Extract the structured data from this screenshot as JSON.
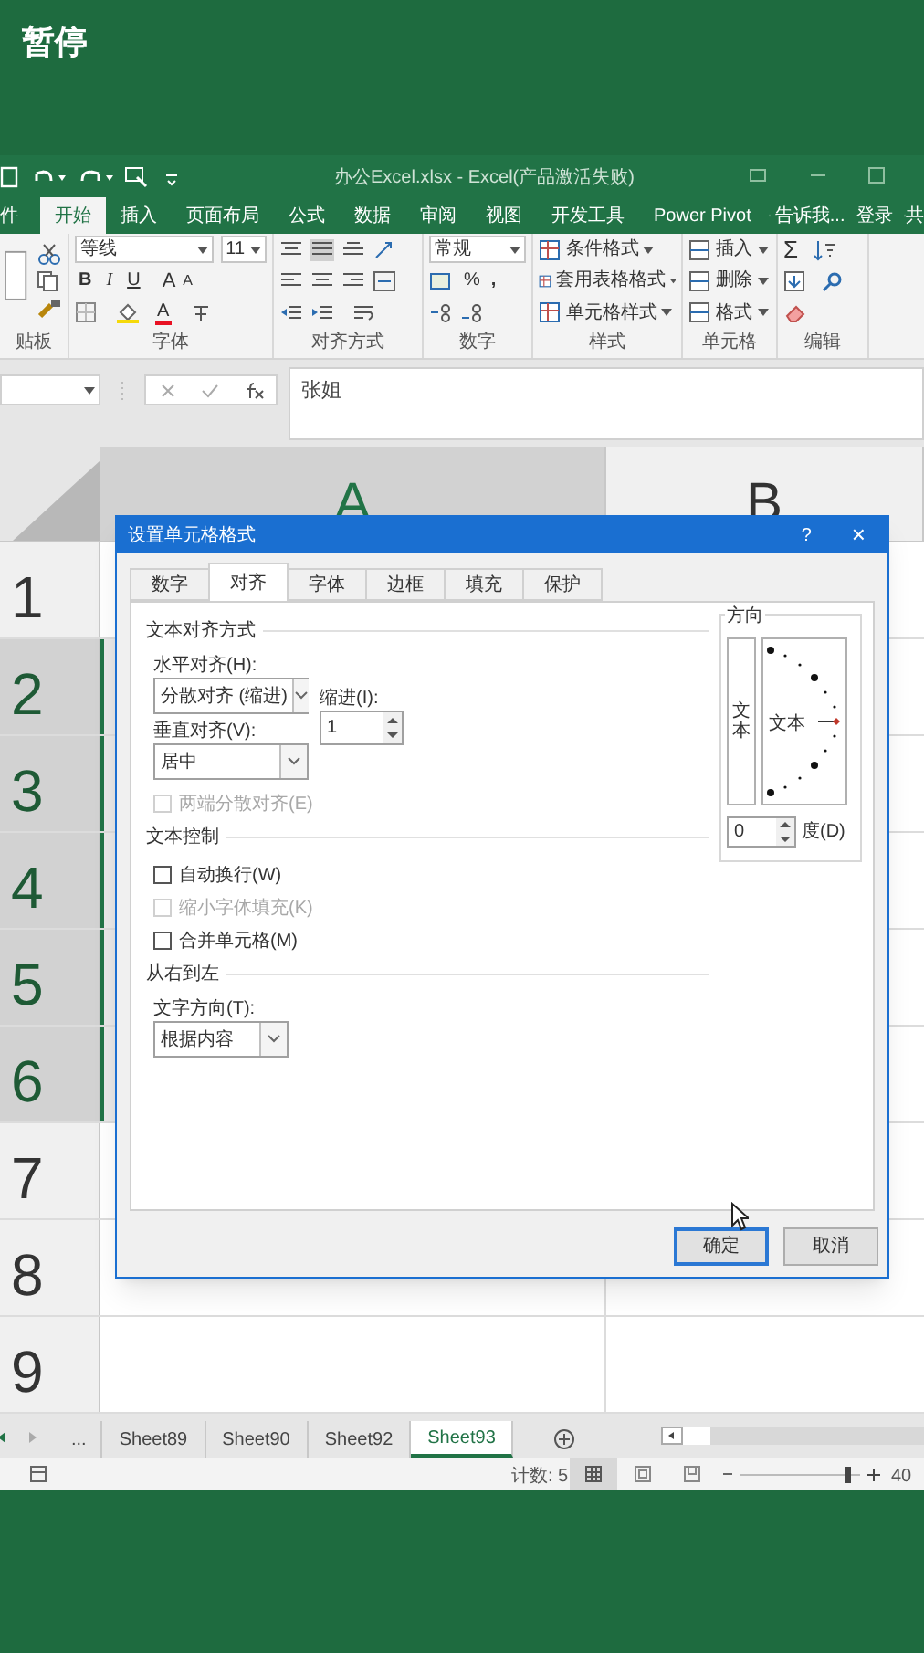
{
  "player_overlay": {
    "label": "暂停"
  },
  "window": {
    "title": "办公Excel.xlsx - Excel(产品激活失败)"
  },
  "ribbon_tabs": [
    {
      "label": "件",
      "selected": false
    },
    {
      "label": "开始",
      "selected": true
    },
    {
      "label": "插入",
      "selected": false
    },
    {
      "label": "页面布局",
      "selected": false
    },
    {
      "label": "公式",
      "selected": false
    },
    {
      "label": "数据",
      "selected": false
    },
    {
      "label": "审阅",
      "selected": false
    },
    {
      "label": "视图",
      "selected": false
    },
    {
      "label": "开发工具",
      "selected": false
    },
    {
      "label": "Power Pivot",
      "selected": false
    }
  ],
  "tell_me": "告诉我...",
  "sign_in": "登录",
  "share": "共",
  "ribbon": {
    "clipboard": {
      "label": "贴板"
    },
    "font": {
      "font_name": "等线",
      "font_size": "11",
      "bold": "B",
      "italic": "I",
      "underline": "U",
      "grow": "A",
      "shrink": "A",
      "font_color": "A",
      "label": "字体"
    },
    "alignment": {
      "label": "对齐方式"
    },
    "number": {
      "format": "常规",
      "percent": "%",
      "comma": ",",
      "label": "数字"
    },
    "styles": {
      "items": [
        "条件格式",
        "套用表格格式",
        "单元格样式"
      ],
      "label": "样式"
    },
    "cells": {
      "items": [
        "插入",
        "删除",
        "格式"
      ],
      "label": "单元格"
    },
    "editing": {
      "sum": "Σ",
      "label": "编辑"
    }
  },
  "formula_bar": {
    "content": "张姐"
  },
  "columns": [
    {
      "label": "A",
      "selected": true
    },
    {
      "label": "B",
      "selected": false
    }
  ],
  "rows": [
    {
      "label": "1",
      "selected": false
    },
    {
      "label": "2",
      "selected": true
    },
    {
      "label": "3",
      "selected": true
    },
    {
      "label": "4",
      "selected": true
    },
    {
      "label": "5",
      "selected": true
    },
    {
      "label": "6",
      "selected": true
    },
    {
      "label": "7",
      "selected": false
    },
    {
      "label": "8",
      "selected": false
    },
    {
      "label": "9",
      "selected": false
    }
  ],
  "sheet_nav": "...",
  "sheet_tabs": [
    {
      "label": "Sheet89",
      "selected": false
    },
    {
      "label": "Sheet90",
      "selected": false
    },
    {
      "label": "Sheet92",
      "selected": false
    },
    {
      "label": "Sheet93",
      "selected": true
    }
  ],
  "status_bar": {
    "count": "计数: 5",
    "zoom_slider": {
      "level": 0.92
    },
    "zoom": "40"
  },
  "dialog": {
    "title": "设置单元格格式",
    "help": "?",
    "close": "×",
    "tabs": [
      {
        "label": "数字",
        "selected": false
      },
      {
        "label": "对齐",
        "selected": true
      },
      {
        "label": "字体",
        "selected": false
      },
      {
        "label": "边框",
        "selected": false
      },
      {
        "label": "填充",
        "selected": false
      },
      {
        "label": "保护",
        "selected": false
      }
    ],
    "text_alignment": {
      "heading": "文本对齐方式",
      "horizontal_label": "水平对齐(H):",
      "horizontal_value": "分散对齐 (缩进)",
      "indent_label": "缩进(I):",
      "indent_value": "1",
      "vertical_label": "垂直对齐(V):",
      "vertical_value": "居中"
    },
    "justify_distributed": {
      "label": "两端分散对齐(E)",
      "checked": false,
      "disabled": true
    },
    "text_control": {
      "heading": "文本控制",
      "options": [
        {
          "label": "自动换行(W)",
          "checked": false,
          "disabled": false
        },
        {
          "label": "缩小字体填充(K)",
          "checked": false,
          "disabled": true
        },
        {
          "label": "合并单元格(M)",
          "checked": false,
          "disabled": false
        }
      ]
    },
    "right_to_left": {
      "heading": "从右到左",
      "direction_label": "文字方向(T):",
      "direction_value": "根据内容"
    },
    "orientation": {
      "heading": "方向",
      "vertical_text": "文本",
      "dial_text": "文本",
      "degrees_value": "0",
      "degrees_label": "度(D)"
    },
    "buttons": [
      {
        "label": "确定",
        "default": true
      },
      {
        "label": "取消",
        "default": false
      }
    ]
  }
}
